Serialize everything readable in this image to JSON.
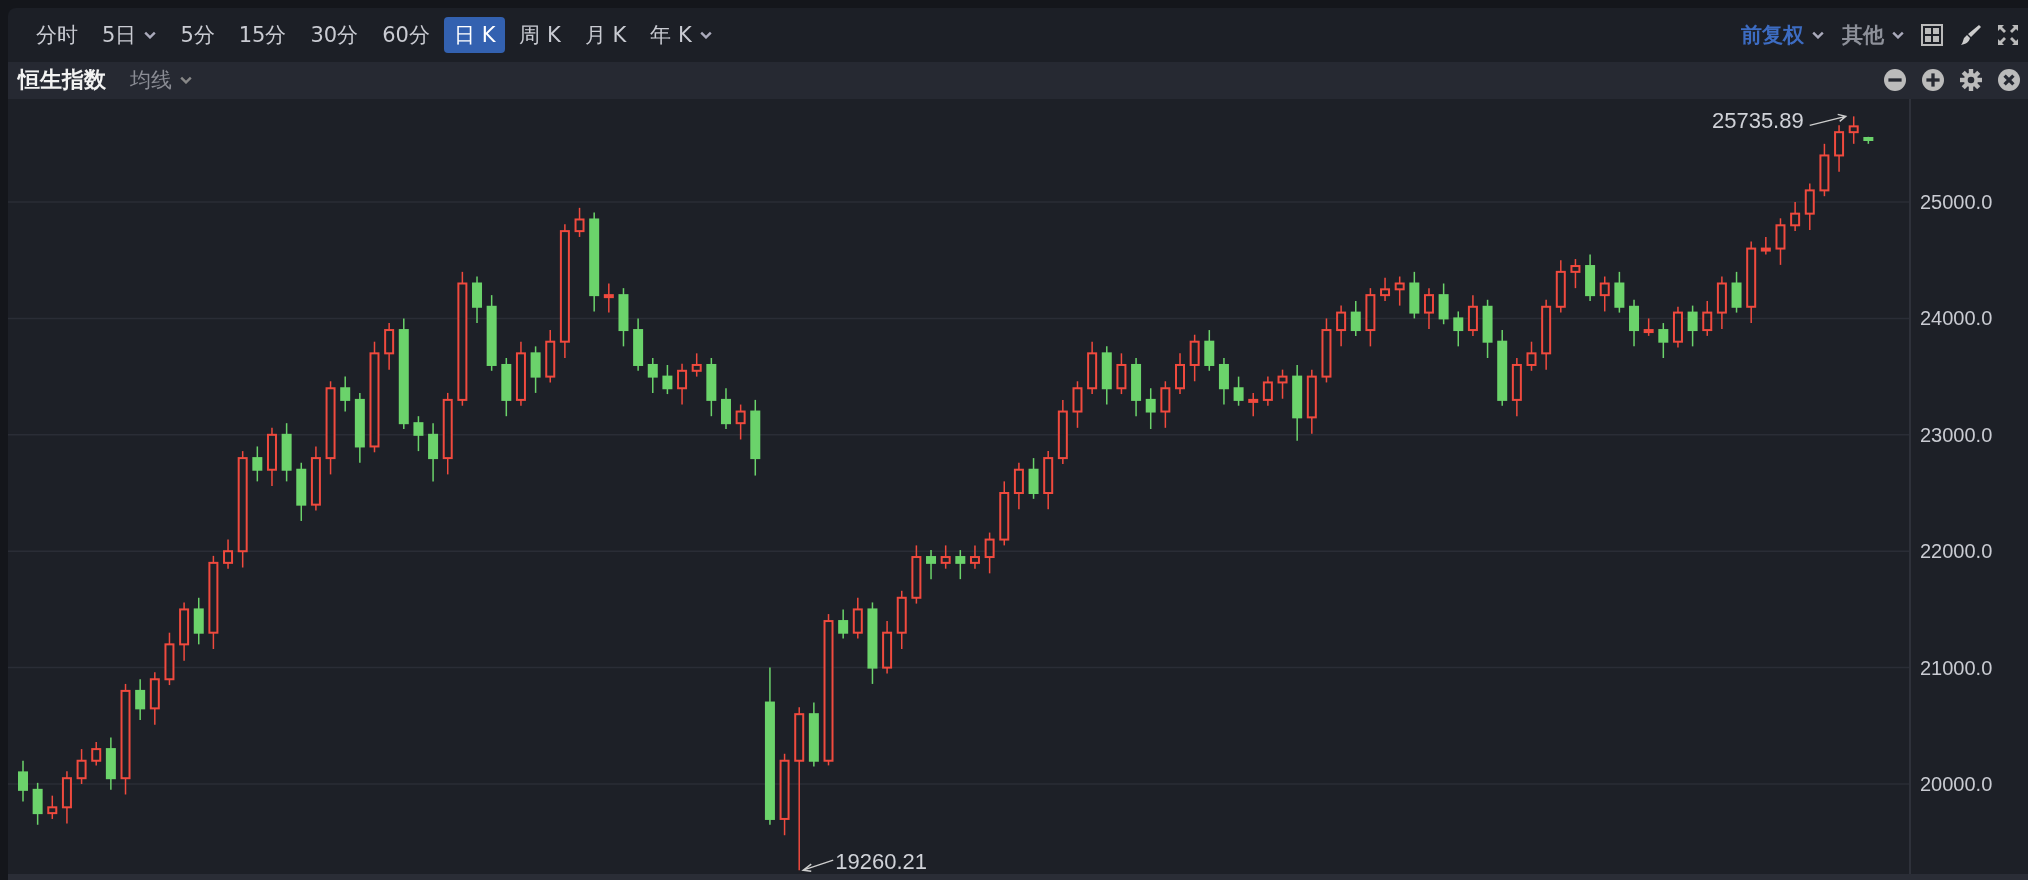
{
  "toolbar": {
    "periods": [
      {
        "label": "分时",
        "selected": false,
        "dropdown": false
      },
      {
        "label": "5日",
        "selected": false,
        "dropdown": true
      },
      {
        "label": "5分",
        "selected": false,
        "dropdown": false
      },
      {
        "label": "15分",
        "selected": false,
        "dropdown": false
      },
      {
        "label": "30分",
        "selected": false,
        "dropdown": false
      },
      {
        "label": "60分",
        "selected": false,
        "dropdown": false
      },
      {
        "label": "日 K",
        "selected": true,
        "dropdown": false
      },
      {
        "label": "周 K",
        "selected": false,
        "dropdown": false
      },
      {
        "label": "月 K",
        "selected": false,
        "dropdown": false
      },
      {
        "label": "年 K",
        "selected": false,
        "dropdown": true
      }
    ],
    "adjust": "前复权",
    "other": "其他"
  },
  "panel": {
    "title": "恒生指数",
    "indicator": "均线"
  },
  "chart_data": {
    "type": "candlestick",
    "grid": true,
    "ylim": [
      19227,
      25885
    ],
    "yticks": [
      {
        "value": 25000,
        "label": "25000.0"
      },
      {
        "value": 24000,
        "label": "24000.0"
      },
      {
        "value": 23000,
        "label": "23000.0"
      },
      {
        "value": 22000,
        "label": "22000.0"
      },
      {
        "value": 21000,
        "label": "21000.0"
      },
      {
        "value": 20000,
        "label": "20000.0"
      }
    ],
    "annotations": [
      "25735.89",
      "19260.21"
    ],
    "ohlc": [
      [
        20100,
        20200,
        19850,
        19950
      ],
      [
        19950,
        20010,
        19650,
        19750
      ],
      [
        19750,
        19900,
        19700,
        19800
      ],
      [
        19800,
        20110,
        19660,
        20050
      ],
      [
        20050,
        20300,
        20000,
        20200
      ],
      [
        20200,
        20360,
        20160,
        20300
      ],
      [
        20300,
        20400,
        19950,
        20050
      ],
      [
        20050,
        20860,
        19910,
        20800
      ],
      [
        20800,
        20900,
        20550,
        20650
      ],
      [
        20650,
        20960,
        20510,
        20900
      ],
      [
        20900,
        21300,
        20850,
        21200
      ],
      [
        21200,
        21560,
        21060,
        21500
      ],
      [
        21500,
        21600,
        21200,
        21300
      ],
      [
        21300,
        21960,
        21160,
        21900
      ],
      [
        21900,
        22100,
        21850,
        22000
      ],
      [
        22000,
        22860,
        21860,
        22800
      ],
      [
        22800,
        22900,
        22600,
        22700
      ],
      [
        22700,
        23060,
        22560,
        23000
      ],
      [
        23000,
        23100,
        22600,
        22700
      ],
      [
        22700,
        22760,
        22260,
        22400
      ],
      [
        22400,
        22900,
        22350,
        22800
      ],
      [
        22800,
        23460,
        22660,
        23400
      ],
      [
        23400,
        23500,
        23200,
        23300
      ],
      [
        23300,
        23360,
        22760,
        22900
      ],
      [
        22900,
        23800,
        22850,
        23700
      ],
      [
        23700,
        23960,
        23560,
        23900
      ],
      [
        23900,
        24000,
        23050,
        23100
      ],
      [
        23100,
        23160,
        22860,
        23000
      ],
      [
        23000,
        23100,
        22600,
        22800
      ],
      [
        22800,
        23360,
        22660,
        23300
      ],
      [
        23300,
        24400,
        23250,
        24300
      ],
      [
        24300,
        24360,
        23960,
        24100
      ],
      [
        24100,
        24200,
        23550,
        23600
      ],
      [
        23600,
        23660,
        23160,
        23300
      ],
      [
        23300,
        23800,
        23250,
        23700
      ],
      [
        23700,
        23760,
        23360,
        23500
      ],
      [
        23500,
        23900,
        23450,
        23800
      ],
      [
        23800,
        24810,
        23660,
        24750
      ],
      [
        24750,
        24950,
        24700,
        24850
      ],
      [
        24850,
        24910,
        24060,
        24200
      ],
      [
        24200,
        24300,
        24050,
        24200
      ],
      [
        24200,
        24260,
        23760,
        23900
      ],
      [
        23900,
        24000,
        23550,
        23600
      ],
      [
        23600,
        23660,
        23360,
        23500
      ],
      [
        23500,
        23600,
        23350,
        23400
      ],
      [
        23400,
        23610,
        23260,
        23550
      ],
      [
        23550,
        23700,
        23500,
        23600
      ],
      [
        23600,
        23660,
        23160,
        23300
      ],
      [
        23300,
        23400,
        23050,
        23100
      ],
      [
        23100,
        23260,
        22960,
        23200
      ],
      [
        23200,
        23300,
        22650,
        22800
      ],
      [
        20700,
        21000,
        19650,
        19700
      ],
      [
        19700,
        20260,
        19560,
        20200
      ],
      [
        20200,
        20660,
        19260.21,
        20600
      ],
      [
        20600,
        20700,
        20150,
        20200
      ],
      [
        20200,
        21460,
        20160,
        21400
      ],
      [
        21400,
        21500,
        21250,
        21300
      ],
      [
        21300,
        21600,
        21250,
        21500
      ],
      [
        21500,
        21560,
        20860,
        21000
      ],
      [
        21000,
        21400,
        20950,
        21300
      ],
      [
        21300,
        21660,
        21160,
        21600
      ],
      [
        21600,
        22050,
        21550,
        21950
      ],
      [
        21950,
        22010,
        21760,
        21900
      ],
      [
        21900,
        22050,
        21850,
        21950
      ],
      [
        21950,
        22010,
        21760,
        21900
      ],
      [
        21900,
        22050,
        21850,
        21950
      ],
      [
        21950,
        22160,
        21810,
        22100
      ],
      [
        22100,
        22600,
        22050,
        22500
      ],
      [
        22500,
        22760,
        22360,
        22700
      ],
      [
        22700,
        22800,
        22450,
        22500
      ],
      [
        22500,
        22860,
        22360,
        22800
      ],
      [
        22800,
        23300,
        22750,
        23200
      ],
      [
        23200,
        23460,
        23060,
        23400
      ],
      [
        23400,
        23800,
        23350,
        23700
      ],
      [
        23700,
        23760,
        23260,
        23400
      ],
      [
        23400,
        23700,
        23350,
        23600
      ],
      [
        23600,
        23660,
        23160,
        23300
      ],
      [
        23300,
        23400,
        23050,
        23200
      ],
      [
        23200,
        23460,
        23060,
        23400
      ],
      [
        23400,
        23700,
        23350,
        23600
      ],
      [
        23600,
        23860,
        23460,
        23800
      ],
      [
        23800,
        23900,
        23550,
        23600
      ],
      [
        23600,
        23660,
        23260,
        23400
      ],
      [
        23400,
        23500,
        23250,
        23300
      ],
      [
        23300,
        23360,
        23160,
        23300
      ],
      [
        23300,
        23500,
        23250,
        23450
      ],
      [
        23450,
        23560,
        23310,
        23500
      ],
      [
        23500,
        23600,
        22950,
        23150
      ],
      [
        23150,
        23560,
        23010,
        23500
      ],
      [
        23500,
        24000,
        23450,
        23900
      ],
      [
        23900,
        24110,
        23760,
        24050
      ],
      [
        24050,
        24150,
        23850,
        23900
      ],
      [
        23900,
        24260,
        23760,
        24200
      ],
      [
        24200,
        24350,
        24150,
        24250
      ],
      [
        24250,
        24360,
        24110,
        24300
      ],
      [
        24300,
        24400,
        24000,
        24050
      ],
      [
        24050,
        24260,
        23910,
        24200
      ],
      [
        24200,
        24300,
        23950,
        24000
      ],
      [
        24000,
        24060,
        23760,
        23900
      ],
      [
        23900,
        24200,
        23850,
        24100
      ],
      [
        24100,
        24160,
        23660,
        23800
      ],
      [
        23800,
        23900,
        23250,
        23300
      ],
      [
        23300,
        23660,
        23160,
        23600
      ],
      [
        23600,
        23800,
        23550,
        23700
      ],
      [
        23700,
        24160,
        23560,
        24100
      ],
      [
        24100,
        24500,
        24050,
        24400
      ],
      [
        24400,
        24510,
        24260,
        24450
      ],
      [
        24450,
        24550,
        24150,
        24200
      ],
      [
        24200,
        24360,
        24060,
        24300
      ],
      [
        24300,
        24400,
        24050,
        24100
      ],
      [
        24100,
        24160,
        23760,
        23900
      ],
      [
        23900,
        24000,
        23850,
        23900
      ],
      [
        23900,
        23960,
        23660,
        23800
      ],
      [
        23800,
        24100,
        23750,
        24050
      ],
      [
        24050,
        24110,
        23760,
        23900
      ],
      [
        23900,
        24150,
        23850,
        24050
      ],
      [
        24050,
        24360,
        23910,
        24300
      ],
      [
        24300,
        24400,
        24050,
        24100
      ],
      [
        24100,
        24660,
        23960,
        24600
      ],
      [
        24600,
        24700,
        24550,
        24600
      ],
      [
        24600,
        24860,
        24460,
        24800
      ],
      [
        24800,
        25000,
        24750,
        24900
      ],
      [
        24900,
        25160,
        24760,
        25100
      ],
      [
        25100,
        25500,
        25050,
        25400
      ],
      [
        25400,
        25660,
        25260,
        25600
      ],
      [
        25600,
        25735.89,
        25500,
        25650
      ],
      [
        25550,
        25560,
        25500,
        25540
      ]
    ]
  }
}
